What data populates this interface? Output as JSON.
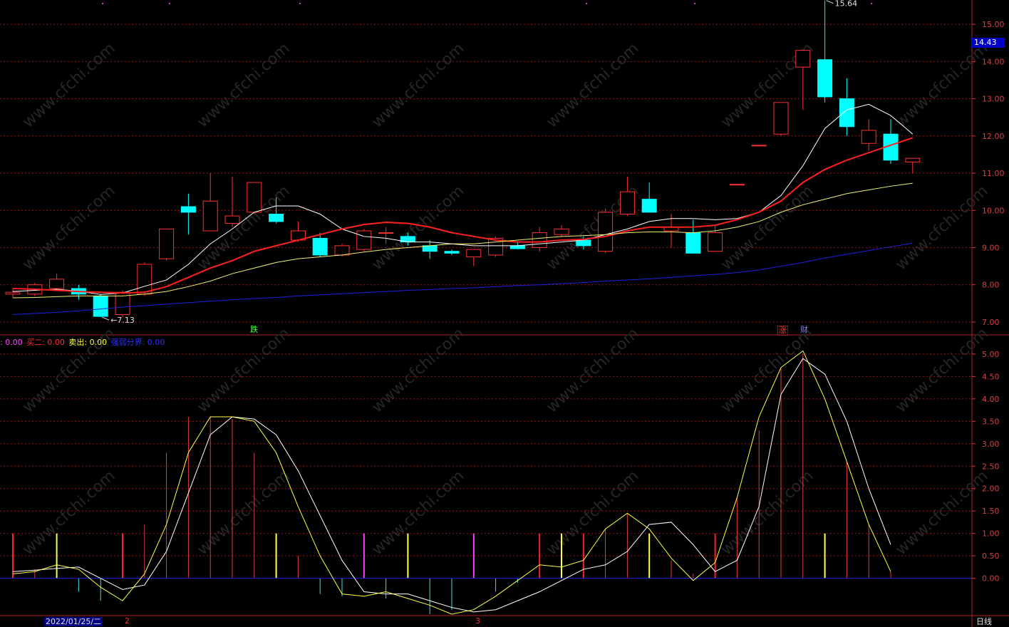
{
  "chart_data": [
    {
      "type": "candlestick",
      "ylim": [
        6.75,
        15.5
      ],
      "yticks": [
        7,
        8,
        9,
        10,
        11,
        12,
        13,
        14,
        15
      ],
      "ytick_labels": [
        "7.00",
        "8.00",
        "9.00",
        "10.00",
        "11.00",
        "12.00",
        "13.00",
        "14.00",
        "15.00"
      ],
      "candles": [
        {
          "o": 7.75,
          "h": 7.9,
          "l": 7.65,
          "c": 7.8
        },
        {
          "o": 7.75,
          "h": 8.05,
          "l": 7.7,
          "c": 8.0
        },
        {
          "o": 7.9,
          "h": 8.3,
          "l": 7.85,
          "c": 8.15
        },
        {
          "o": 7.9,
          "h": 8.0,
          "l": 7.6,
          "c": 7.75
        },
        {
          "o": 7.7,
          "h": 7.75,
          "l": 7.13,
          "c": 7.15
        },
        {
          "o": 7.2,
          "h": 7.85,
          "l": 7.13,
          "c": 7.8
        },
        {
          "o": 7.75,
          "h": 8.6,
          "l": 7.7,
          "c": 8.55
        },
        {
          "o": 8.7,
          "h": 9.5,
          "l": 8.65,
          "c": 9.5
        },
        {
          "o": 10.1,
          "h": 10.45,
          "l": 9.35,
          "c": 9.95
        },
        {
          "o": 9.45,
          "h": 11.0,
          "l": 9.45,
          "c": 10.25
        },
        {
          "o": 9.65,
          "h": 10.9,
          "l": 9.55,
          "c": 9.85
        },
        {
          "o": 9.95,
          "h": 10.75,
          "l": 9.9,
          "c": 10.75
        },
        {
          "o": 9.9,
          "h": 10.35,
          "l": 9.65,
          "c": 9.7
        },
        {
          "o": 9.2,
          "h": 9.7,
          "l": 9.15,
          "c": 9.45
        },
        {
          "o": 9.25,
          "h": 9.4,
          "l": 8.75,
          "c": 8.8
        },
        {
          "o": 8.8,
          "h": 9.1,
          "l": 8.75,
          "c": 9.05
        },
        {
          "o": 8.95,
          "h": 9.5,
          "l": 8.9,
          "c": 9.45
        },
        {
          "o": 9.4,
          "h": 9.55,
          "l": 9.1,
          "c": 9.4
        },
        {
          "o": 9.3,
          "h": 9.4,
          "l": 9.05,
          "c": 9.15
        },
        {
          "o": 9.05,
          "h": 9.2,
          "l": 8.7,
          "c": 8.9
        },
        {
          "o": 8.9,
          "h": 8.95,
          "l": 8.8,
          "c": 8.85
        },
        {
          "o": 8.75,
          "h": 8.95,
          "l": 8.5,
          "c": 8.95
        },
        {
          "o": 8.8,
          "h": 9.3,
          "l": 8.75,
          "c": 9.25
        },
        {
          "o": 9.05,
          "h": 9.15,
          "l": 8.95,
          "c": 8.97
        },
        {
          "o": 9.0,
          "h": 9.55,
          "l": 8.9,
          "c": 9.4
        },
        {
          "o": 9.35,
          "h": 9.6,
          "l": 9.3,
          "c": 9.5
        },
        {
          "o": 9.2,
          "h": 9.3,
          "l": 8.95,
          "c": 9.05
        },
        {
          "o": 8.9,
          "h": 10.05,
          "l": 8.85,
          "c": 9.95
        },
        {
          "o": 9.9,
          "h": 10.9,
          "l": 9.85,
          "c": 10.5
        },
        {
          "o": 10.3,
          "h": 10.75,
          "l": 9.95,
          "c": 9.95
        },
        {
          "o": 9.45,
          "h": 9.9,
          "l": 9.0,
          "c": 9.55
        },
        {
          "o": 9.4,
          "h": 9.75,
          "l": 8.85,
          "c": 8.85
        },
        {
          "o": 8.9,
          "h": 9.6,
          "l": 8.9,
          "c": 9.4
        },
        {
          "o": 10.7,
          "h": 10.7,
          "l": 10.7,
          "c": 10.7
        },
        {
          "o": 11.75,
          "h": 11.75,
          "l": 11.75,
          "c": 11.75
        },
        {
          "o": 12.05,
          "h": 12.9,
          "l": 12.0,
          "c": 12.9
        },
        {
          "o": 13.85,
          "h": 14.3,
          "l": 12.7,
          "c": 14.3
        },
        {
          "o": 14.05,
          "h": 15.64,
          "l": 12.9,
          "c": 13.05
        },
        {
          "o": 13.0,
          "h": 13.55,
          "l": 12.0,
          "c": 12.25
        },
        {
          "o": 11.8,
          "h": 12.45,
          "l": 11.6,
          "c": 12.15
        },
        {
          "o": 12.05,
          "h": 12.45,
          "l": 11.25,
          "c": 11.35
        },
        {
          "o": 11.3,
          "h": 11.4,
          "l": 11.0,
          "c": 11.4
        }
      ],
      "series": [
        {
          "name": "MA5",
          "color": "#ffffff",
          "values": [
            7.82,
            7.85,
            7.88,
            7.83,
            7.74,
            7.78,
            7.96,
            8.13,
            8.55,
            9.1,
            9.5,
            9.95,
            10.12,
            10.12,
            9.9,
            9.5,
            9.3,
            9.25,
            9.15,
            9.15,
            9.1,
            9.05,
            9.05,
            9.05,
            9.1,
            9.15,
            9.2,
            9.35,
            9.5,
            9.7,
            9.78,
            9.78,
            9.75,
            9.78,
            9.95,
            10.4,
            11.2,
            12.2,
            12.7,
            12.85,
            12.55,
            12.05
          ]
        },
        {
          "name": "MA10",
          "color": "#ff2020",
          "values": [
            7.9,
            7.88,
            7.85,
            7.82,
            7.8,
            7.78,
            7.8,
            7.95,
            8.2,
            8.45,
            8.65,
            8.9,
            9.05,
            9.2,
            9.35,
            9.5,
            9.62,
            9.68,
            9.65,
            9.55,
            9.4,
            9.3,
            9.2,
            9.15,
            9.15,
            9.2,
            9.22,
            9.3,
            9.45,
            9.55,
            9.55,
            9.55,
            9.6,
            9.75,
            9.95,
            10.25,
            10.75,
            11.1,
            11.35,
            11.55,
            11.75,
            11.95
          ]
        },
        {
          "name": "MA20",
          "color": "#f0f070",
          "values": [
            7.65,
            7.66,
            7.68,
            7.7,
            7.7,
            7.7,
            7.75,
            7.82,
            7.95,
            8.1,
            8.3,
            8.45,
            8.6,
            8.7,
            8.75,
            8.8,
            8.88,
            8.95,
            9.0,
            9.05,
            9.1,
            9.1,
            9.15,
            9.2,
            9.25,
            9.3,
            9.32,
            9.35,
            9.4,
            9.42,
            9.42,
            9.4,
            9.45,
            9.55,
            9.7,
            9.95,
            10.15,
            10.3,
            10.45,
            10.55,
            10.65,
            10.73
          ]
        },
        {
          "name": "MA60",
          "color": "#2020e0",
          "values": [
            7.2,
            7.23,
            7.26,
            7.3,
            7.35,
            7.4,
            7.44,
            7.48,
            7.52,
            7.56,
            7.6,
            7.63,
            7.66,
            7.7,
            7.73,
            7.76,
            7.79,
            7.82,
            7.85,
            7.87,
            7.9,
            7.92,
            7.95,
            7.98,
            8.0,
            8.03,
            8.06,
            8.1,
            8.13,
            8.16,
            8.2,
            8.24,
            8.28,
            8.33,
            8.4,
            8.5,
            8.6,
            8.72,
            8.82,
            8.92,
            9.02,
            9.12
          ]
        }
      ],
      "annotations": [
        {
          "text": "15.64",
          "x_index": 37,
          "y": 15.64
        },
        {
          "text": "7.13",
          "x_index": 4,
          "y": 7.13
        }
      ],
      "current_price": "14.43"
    },
    {
      "type": "line",
      "ylim": [
        -0.8,
        5.3
      ],
      "yticks": [
        0,
        0.5,
        1.0,
        1.5,
        2.0,
        2.5,
        3.0,
        3.5,
        4.0,
        4.5,
        5.0
      ],
      "ytick_labels": [
        "0.00",
        "0.50",
        "1.00",
        "1.50",
        "2.00",
        "2.50",
        "3.00",
        "3.50",
        "4.00",
        "4.50",
        "5.00"
      ],
      "series": [
        {
          "name": "white",
          "color": "#ffffff",
          "values": [
            0.15,
            0.18,
            0.22,
            0.25,
            0.0,
            -0.25,
            -0.15,
            0.6,
            1.9,
            3.2,
            3.6,
            3.55,
            3.2,
            2.4,
            1.4,
            0.4,
            -0.3,
            -0.35,
            -0.35,
            -0.5,
            -0.65,
            -0.75,
            -0.7,
            -0.5,
            -0.3,
            -0.05,
            0.2,
            0.3,
            0.6,
            1.2,
            1.25,
            0.75,
            0.15,
            0.4,
            1.6,
            4.1,
            4.9,
            4.55,
            3.5,
            2.0,
            0.75
          ]
        },
        {
          "name": "yellow",
          "color": "#ffff40",
          "values": [
            0.1,
            0.15,
            0.3,
            0.2,
            -0.2,
            -0.5,
            0.1,
            1.2,
            2.8,
            3.6,
            3.6,
            3.5,
            2.8,
            1.6,
            0.5,
            -0.35,
            -0.4,
            -0.3,
            -0.45,
            -0.6,
            -0.8,
            -0.7,
            -0.4,
            -0.05,
            0.3,
            0.25,
            0.4,
            1.1,
            1.45,
            1.1,
            0.45,
            -0.05,
            0.35,
            1.8,
            3.6,
            4.7,
            5.07,
            4.0,
            2.6,
            1.2,
            0.15
          ]
        }
      ],
      "bars": [
        {
          "value": 1.0,
          "color": "#ff2020"
        },
        {
          "value": 0.2,
          "color": "#d84040"
        },
        {
          "value": 1.0,
          "color": "#ffff40"
        },
        {
          "value": -0.3,
          "color": "#40e0e0"
        },
        {
          "value": -0.5,
          "color": "#40e0e0"
        },
        {
          "value": 1.0,
          "color": "#ff2020"
        },
        {
          "value": 1.2,
          "color": "#d84040"
        },
        {
          "value": 2.8,
          "color": "#d84040"
        },
        {
          "value": 3.6,
          "color": "#d84040"
        },
        {
          "value": 3.6,
          "color": "#d84040"
        },
        {
          "value": 3.55,
          "color": "#d84040"
        },
        {
          "value": 2.8,
          "color": "#d84040"
        },
        {
          "value": 1.0,
          "color": "#ffff40"
        },
        {
          "value": 0.5,
          "color": "#d84040"
        },
        {
          "value": -0.35,
          "color": "#40e0e0"
        },
        {
          "value": -0.4,
          "color": "#40e0e0"
        },
        {
          "value": 1.0,
          "color": "#ff40ff"
        },
        {
          "value": -0.45,
          "color": "#40e0e0"
        },
        {
          "value": 1.0,
          "color": "#ffff40"
        },
        {
          "value": -0.8,
          "color": "#40e0e0"
        },
        {
          "value": -0.7,
          "color": "#40e0e0"
        },
        {
          "value": 1.0,
          "color": "#ff40ff"
        },
        {
          "value": -0.3,
          "color": "#40e0e0"
        },
        {
          "value": -0.1,
          "color": "#40e0e0"
        },
        {
          "value": 1.0,
          "color": "#ff2020"
        },
        {
          "value": 1.0,
          "color": "#ffff40"
        },
        {
          "value": 1.0,
          "color": "#ff2020"
        },
        {
          "value": 1.1,
          "color": "#d84040"
        },
        {
          "value": 1.45,
          "color": "#d84040"
        },
        {
          "value": 1.0,
          "color": "#ffff40"
        },
        {
          "value": 0.4,
          "color": "#d84040"
        },
        {
          "value": 0.1,
          "color": "#d84040"
        },
        {
          "value": 1.0,
          "color": "#ff2020"
        },
        {
          "value": 1.8,
          "color": "#d84040"
        },
        {
          "value": 3.3,
          "color": "#d84040"
        },
        {
          "value": 4.7,
          "color": "#d84040"
        },
        {
          "value": 5.0,
          "color": "#d84040"
        },
        {
          "value": 1.0,
          "color": "#ffff40"
        },
        {
          "value": 2.6,
          "color": "#d84040"
        },
        {
          "value": 1.2,
          "color": "#d84040"
        },
        {
          "value": 0.15,
          "color": "#ff2020"
        }
      ],
      "zero_line_color": "#2020e0"
    }
  ],
  "indicator_legend": [
    {
      "text": ": 0.00",
      "color": "#ff40ff"
    },
    {
      "text": "买二: 0.00",
      "color": "#ff3030"
    },
    {
      "text": "卖出: 0.00",
      "color": "#ffff40"
    },
    {
      "text": "强弱分界: 0.00",
      "color": "#3030ff"
    }
  ],
  "signals": [
    {
      "text": "跌",
      "color": "#40ff40"
    },
    {
      "text": "涨",
      "color": "#ff3030"
    },
    {
      "text": "财",
      "color": "#8080ff"
    }
  ],
  "bottom_markers": [
    "2",
    "3"
  ],
  "date_label": "2022/01/25/二",
  "period_label": "日线",
  "watermark": "www.cfchi.com",
  "colors": {
    "up": "#ff3030",
    "down": "#00ffff",
    "grid": "#a01010",
    "axis": "#d84040"
  }
}
